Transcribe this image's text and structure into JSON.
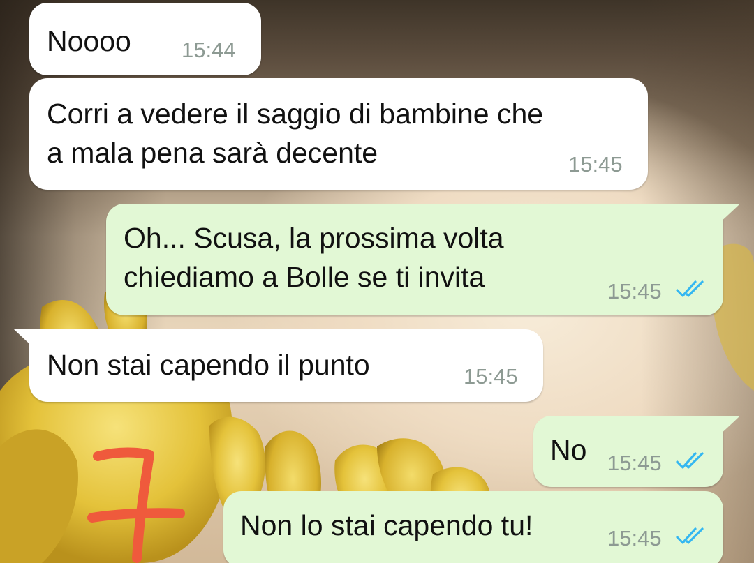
{
  "colors": {
    "incoming_bubble": "#ffffff",
    "outgoing_bubble": "#e2f8d5",
    "timestamp": "#8d9a93",
    "read_ticks": "#34b7f1",
    "annotation": "#ef5a3c"
  },
  "messages": [
    {
      "direction": "incoming",
      "text": "Noooo",
      "time": "15:44"
    },
    {
      "direction": "incoming",
      "lines": [
        "Corri a vedere il saggio di bambine che",
        "a mala pena sarà decente"
      ],
      "time": "15:45"
    },
    {
      "direction": "outgoing",
      "lines": [
        "Oh... Scusa, la prossima volta",
        "chiediamo a Bolle se ti invita"
      ],
      "time": "15:45",
      "status": "read-ticks-icon"
    },
    {
      "direction": "incoming",
      "text": "Non stai capendo il punto",
      "time": "15:45"
    },
    {
      "direction": "outgoing",
      "text": "No",
      "time": "15:45",
      "status": "read-ticks-icon"
    },
    {
      "direction": "outgoing",
      "text": "Non lo stai capendo tu!",
      "time": "15:45",
      "status": "read-ticks-icon"
    }
  ],
  "annotation_mark": "7"
}
